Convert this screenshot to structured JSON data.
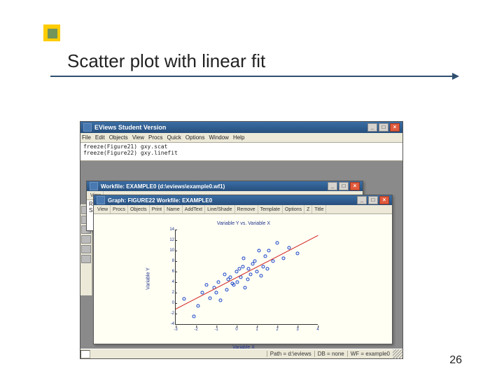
{
  "slide": {
    "title": "Scatter plot with linear fit",
    "page_number": "26"
  },
  "app": {
    "title": "EViews Student Version",
    "menus": [
      "File",
      "Edit",
      "Objects",
      "View",
      "Procs",
      "Quick",
      "Options",
      "Window",
      "Help"
    ],
    "command_text": "freeze(Figure21) gxy.scat\nfreeze(Figure22) gxy.linefit",
    "status": {
      "path": "Path = d:\\eviews",
      "db": "DB = none",
      "wf": "WF = example0"
    }
  },
  "workfile": {
    "title": "Workfile: EXAMPLE0  (d:\\eviews\\example0.wf1)",
    "toolbar": [
      "View"
    ],
    "body_lines": [
      "Range:",
      "Sample:"
    ]
  },
  "graph": {
    "title": "Graph: FIGURE22   Workfile: EXAMPLE0",
    "toolbar": [
      "View",
      "Procs",
      "Objects",
      "Print",
      "Name",
      "AddText",
      "Line/Shade",
      "Remove",
      "Template",
      "Options",
      "Z",
      "Title"
    ]
  },
  "chart_data": {
    "type": "scatter",
    "title": "Variable Y vs. Variable X",
    "xlabel": "Variable X",
    "ylabel": "Variable Y",
    "xlim": [
      -3,
      4
    ],
    "ylim": [
      -4,
      14
    ],
    "xticks": [
      -3,
      -2,
      -1,
      0,
      1,
      2,
      3,
      4
    ],
    "yticks": [
      -4,
      -2,
      0,
      2,
      4,
      6,
      8,
      10,
      12,
      14
    ],
    "series": [
      {
        "name": "data",
        "type": "scatter",
        "x": [
          -2.6,
          -2.1,
          -1.7,
          -1.5,
          -1.3,
          -1.1,
          -0.9,
          -0.8,
          -0.6,
          -0.5,
          -0.4,
          -0.3,
          -0.15,
          0,
          0.05,
          0.15,
          0.2,
          0.35,
          0.55,
          0.6,
          0.7,
          0.8,
          1.0,
          1.1,
          1.3,
          1.4,
          1.5,
          1.8,
          2.0,
          2.3,
          2.6,
          3.0,
          -1.9,
          -1.0,
          0.3,
          0.9,
          1.6,
          0.4,
          -0.2,
          1.2
        ],
        "y": [
          0.8,
          -2.5,
          2.0,
          3.5,
          1.0,
          3.0,
          4.0,
          0.5,
          5.5,
          2.5,
          4.5,
          5.0,
          3.5,
          6.0,
          4.0,
          6.5,
          5.0,
          8.5,
          4.5,
          6.5,
          5.5,
          7.5,
          6.0,
          10.0,
          7.0,
          9.0,
          6.5,
          8.0,
          11.5,
          8.5,
          10.5,
          9.5,
          -0.5,
          2.0,
          7.0,
          8.0,
          10.0,
          3.0,
          3.8,
          5.2
        ]
      }
    ],
    "fit": {
      "slope": 2.0,
      "intercept": 5.0
    }
  }
}
